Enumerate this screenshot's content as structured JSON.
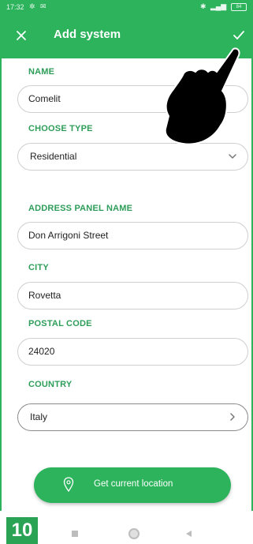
{
  "status_bar": {
    "time": "17:32",
    "battery": "84"
  },
  "toolbar": {
    "title": "Add system"
  },
  "form": {
    "name": {
      "label": "NAME",
      "value": "Comelit"
    },
    "type": {
      "label": "CHOOSE TYPE",
      "value": "Residential"
    },
    "address": {
      "label": "ADDRESS PANEL NAME",
      "value": "Don Arrigoni Street"
    },
    "city": {
      "label": "CITY",
      "value": "Rovetta"
    },
    "postal": {
      "label": "POSTAL CODE",
      "value": "24020"
    },
    "country": {
      "label": "COUNTRY",
      "value": "Italy"
    }
  },
  "location_button": {
    "label": "Get current location"
  },
  "step_badge": "10",
  "colors": {
    "primary": "#2cb35c",
    "label_green": "#2e9d59"
  }
}
